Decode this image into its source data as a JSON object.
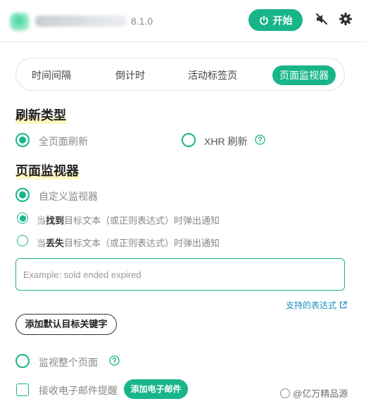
{
  "header": {
    "version": "8.1.0",
    "start_label": "开始"
  },
  "tabs": [
    {
      "label": "时间间隔",
      "active": false
    },
    {
      "label": "倒计时",
      "active": false
    },
    {
      "label": "活动标签页",
      "active": false
    },
    {
      "label": "页面监视器",
      "active": true
    }
  ],
  "refresh_type": {
    "title": "刷新类型",
    "options": [
      {
        "label": "全页面刷新",
        "checked": true
      },
      {
        "label": "XHR 刷新",
        "checked": false
      }
    ]
  },
  "page_monitor": {
    "title": "页面监视器",
    "custom_label": "自定义监视器",
    "custom_checked": true,
    "found_option": {
      "prefix": "当",
      "keyword": "找到",
      "suffix": "目标文本（或正则表达式）时弹出通知",
      "checked": true
    },
    "lost_option": {
      "prefix": "当",
      "keyword": "丢失",
      "suffix": "目标文本（或正则表达式）时弹出通知",
      "checked": false
    },
    "input_placeholder": "Example: sold ended expired",
    "input_value": "",
    "expressions_link": "支持的表达式",
    "add_default_button": "添加默认目标关键字",
    "whole_page_label": "监视整个页面",
    "whole_page_checked": false,
    "email_alert_label": "接收电子邮件提醒",
    "email_alert_checked": false,
    "add_email_button": "添加电子邮件"
  },
  "watermark": "@亿万精品源",
  "colors": {
    "accent": "#19b58a",
    "link": "#1a8fc2"
  }
}
